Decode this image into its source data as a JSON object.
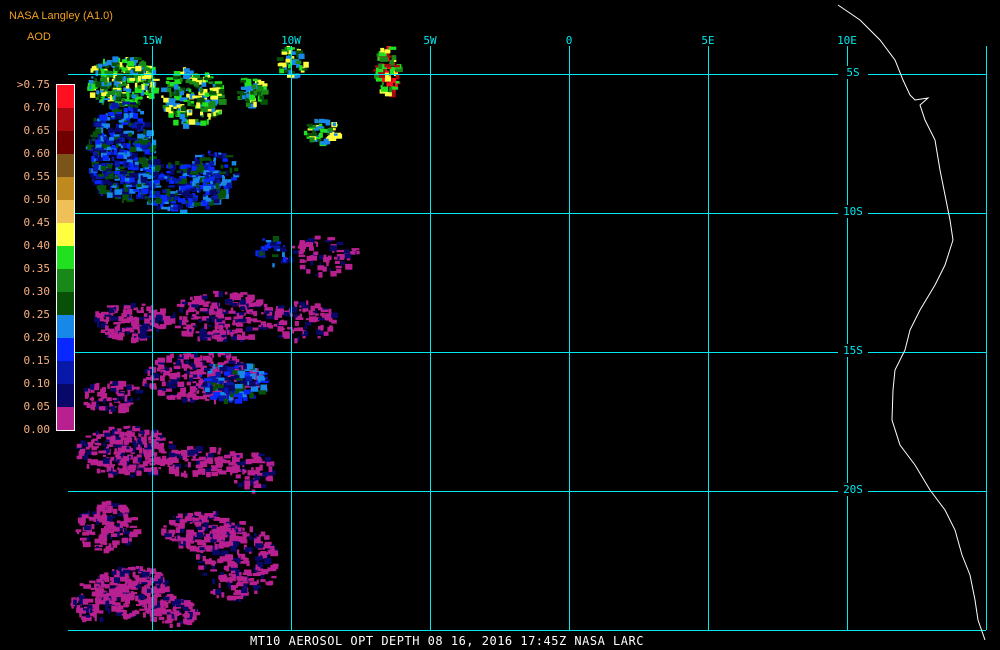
{
  "header": {
    "title": "NASA Langley (A1.0)",
    "unit": "AOD"
  },
  "colors": {
    "title": "#f0a020",
    "labels": "#f8b080",
    "grid": "#00e8f0",
    "coast": "#ffffff"
  },
  "legend": {
    "labels": [
      ">0.75",
      "0.70",
      "0.65",
      "0.60",
      "0.55",
      "0.50",
      "0.45",
      "0.40",
      "0.35",
      "0.30",
      "0.25",
      "0.20",
      "0.15",
      "0.10",
      "0.05",
      "0.00"
    ],
    "colors": [
      "#ff1020",
      "#a80810",
      "#700000",
      "#7a5418",
      "#be8a20",
      "#f0c058",
      "#ffff40",
      "#20e020",
      "#188818",
      "#085008",
      "#1888e8",
      "#0828ff",
      "#0818a8",
      "#080868",
      "#b82090"
    ]
  },
  "grid": {
    "longitudes": [
      "15W",
      "10W",
      "5W",
      "0",
      "5E",
      "10E"
    ],
    "latitudes": [
      "5S",
      "10S",
      "15S",
      "20S"
    ]
  },
  "footer": "MT10   AEROSOL OPT DEPTH   08 16, 2016 17:45Z   NASA LARC"
}
